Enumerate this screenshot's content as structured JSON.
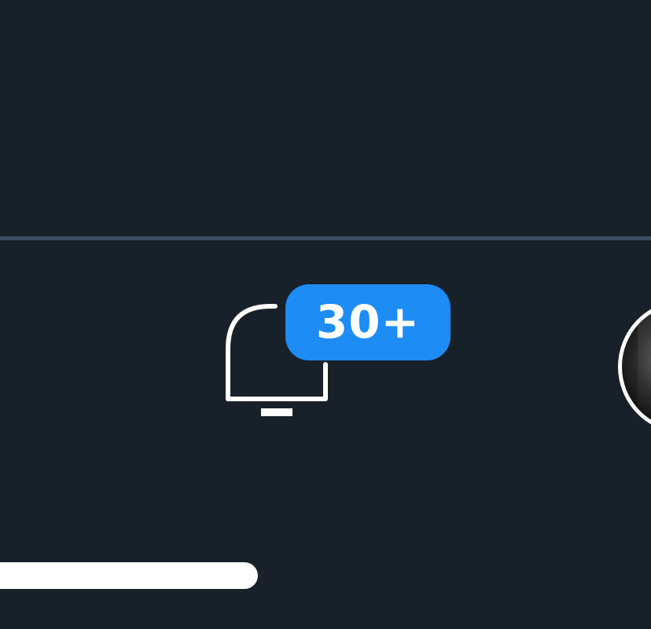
{
  "notifications": {
    "icon": "bell-icon",
    "badge_text": "30+",
    "badge_color": "#1d8cf5"
  },
  "profile": {
    "icon": "avatar"
  },
  "theme": {
    "background": "#18202a",
    "divider": "#3a4c62",
    "icon_color": "#ffffff"
  }
}
